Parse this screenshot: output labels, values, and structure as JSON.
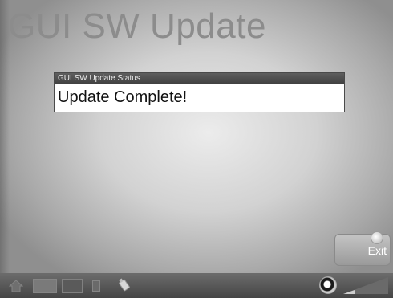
{
  "header": {
    "title": "GUI SW Update"
  },
  "status_panel": {
    "header": "GUI SW Update Status",
    "message": "Update Complete!"
  },
  "exit_button": {
    "label": "Exit"
  },
  "bottom_bar": {
    "icons": [
      "home-icon",
      "grid-icon",
      "screen-icon",
      "mini-device-icon",
      "usb-icon",
      "volume-knob-icon",
      "volume-level-icon"
    ]
  }
}
